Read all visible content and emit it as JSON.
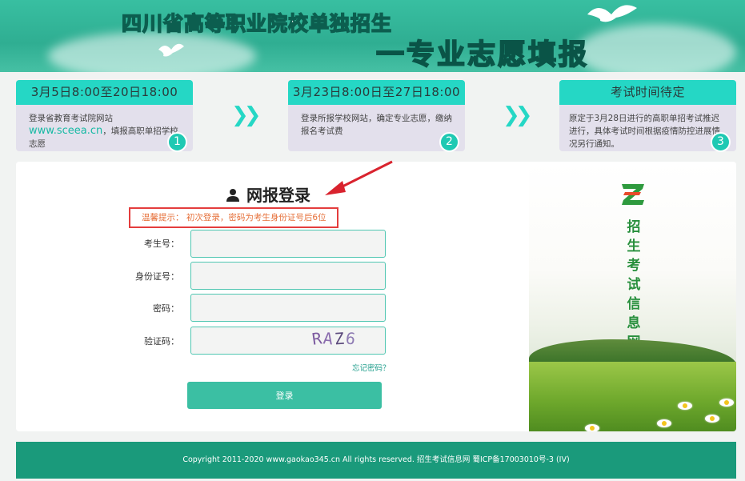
{
  "header": {
    "title_line1": "四川省高等职业院校单独招生",
    "title_line2": "一专业志愿填报"
  },
  "steps": [
    {
      "head": "3月5日8:00至20日18:00",
      "body_text": "登录省教育考试院网站",
      "link": "www.sceea.cn",
      "body_text2": "，填报高职单招学校志愿",
      "num": "1"
    },
    {
      "head": "3月23日8:00日至27日18:00",
      "body_text": "登录所报学校网站，确定专业志愿，缴纳报名考试费",
      "num": "2"
    },
    {
      "head": "考试时间待定",
      "body_text": "原定于3月28日进行的高职单招考试推迟进行，具体考试时间根据疫情防控进展情况另行通知。",
      "num": "3"
    }
  ],
  "arrows": {
    "glyph": "❯❯"
  },
  "login": {
    "title": "网报登录",
    "hint": "温馨提示： 初次登录，密码为考生身份证号后6位",
    "fields": {
      "exam_no_label": "考生号：",
      "id_card_label": "身份证号：",
      "password_label": "密码：",
      "captcha_label": "验证码："
    },
    "captcha_text": [
      "R",
      "A",
      "Z",
      "6"
    ],
    "forgot": "忘记密码？",
    "submit": "登录"
  },
  "side": {
    "vertical_text": "招生考试信息网"
  },
  "footer": {
    "copyright": "Copyright 2011-2020 www.gaokao345.cn All rights reserved. 招生考试信息网 蜀ICP备17003010号-3 (IV)"
  },
  "colors": {
    "accent": "#25d7c5",
    "header_bg": "#38bfa1",
    "footer_bg": "#1a9a7b",
    "hint_border": "#e43d3d",
    "hint_text": "#e6703a"
  }
}
